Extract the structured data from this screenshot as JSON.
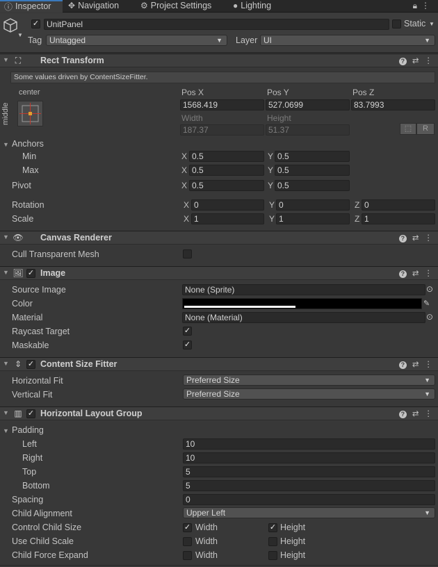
{
  "tabs": [
    {
      "label": "Inspector",
      "icon": "info-icon"
    },
    {
      "label": "Navigation",
      "icon": "navigation-icon"
    },
    {
      "label": "Project Settings",
      "icon": "gear-icon"
    },
    {
      "label": "Lighting",
      "icon": "bulb-icon"
    }
  ],
  "object": {
    "name": "UnitPanel",
    "active": true,
    "static_label": "Static",
    "static_checked": false,
    "tag_label": "Tag",
    "tag_value": "Untagged",
    "layer_label": "Layer",
    "layer_value": "UI"
  },
  "rect_transform": {
    "title": "Rect Transform",
    "help_text": "Some values driven by ContentSizeFitter.",
    "anchor_h": "center",
    "anchor_v": "middle",
    "pos_x_label": "Pos X",
    "pos_y_label": "Pos Y",
    "pos_z_label": "Pos Z",
    "pos_x": "1568.419",
    "pos_y": "527.0699",
    "pos_z": "83.7993",
    "width_label": "Width",
    "height_label": "Height",
    "width": "187.37",
    "height": "51.37",
    "r_button": "R",
    "anchors_label": "Anchors",
    "min_label": "Min",
    "max_label": "Max",
    "min_x": "0.5",
    "min_y": "0.5",
    "max_x": "0.5",
    "max_y": "0.5",
    "pivot_label": "Pivot",
    "pivot_x": "0.5",
    "pivot_y": "0.5",
    "rotation_label": "Rotation",
    "rot_x": "0",
    "rot_y": "0",
    "rot_z": "0",
    "scale_label": "Scale",
    "scale_x": "1",
    "scale_y": "1",
    "scale_z": "1",
    "axis_x": "X",
    "axis_y": "Y",
    "axis_z": "Z"
  },
  "canvas_renderer": {
    "title": "Canvas Renderer",
    "cull_label": "Cull Transparent Mesh",
    "cull_checked": false
  },
  "image": {
    "title": "Image",
    "source_label": "Source Image",
    "source_value": "None (Sprite)",
    "color_label": "Color",
    "color_value": "#000000",
    "material_label": "Material",
    "material_value": "None (Material)",
    "raycast_label": "Raycast Target",
    "raycast_checked": true,
    "maskable_label": "Maskable",
    "maskable_checked": true
  },
  "content_size_fitter": {
    "title": "Content Size Fitter",
    "hfit_label": "Horizontal Fit",
    "hfit_value": "Preferred Size",
    "vfit_label": "Vertical Fit",
    "vfit_value": "Preferred Size"
  },
  "layout_group": {
    "title": "Horizontal Layout Group",
    "padding_label": "Padding",
    "left_label": "Left",
    "left_value": "10",
    "right_label": "Right",
    "right_value": "10",
    "top_label": "Top",
    "top_value": "5",
    "bottom_label": "Bottom",
    "bottom_value": "5",
    "spacing_label": "Spacing",
    "spacing_value": "0",
    "alignment_label": "Child Alignment",
    "alignment_value": "Upper Left",
    "control_label": "Control Child Size",
    "scale_label": "Use Child Scale",
    "expand_label": "Child Force Expand",
    "width_label": "Width",
    "height_label": "Height",
    "control_width": true,
    "control_height": true,
    "scale_width": false,
    "scale_height": false,
    "expand_width": false,
    "expand_height": false
  },
  "colors": {
    "accent": "#3a79bb",
    "background": "#383838"
  }
}
